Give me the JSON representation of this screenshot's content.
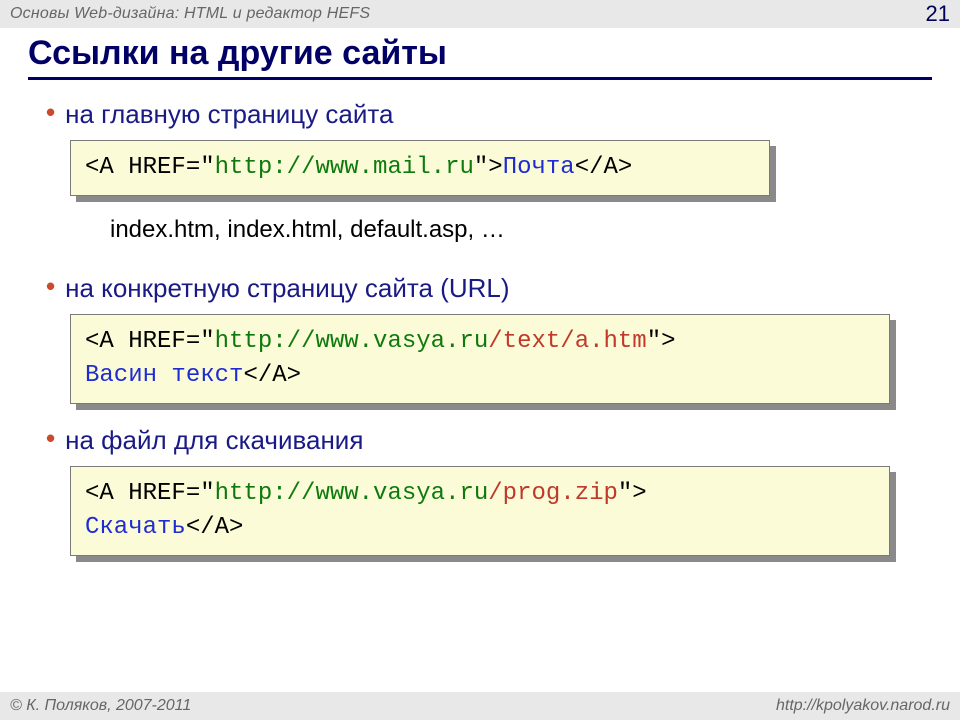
{
  "header": {
    "breadcrumb": "Основы Web-дизайна: HTML и редактор HEFS",
    "pagenum": "21"
  },
  "title": "Ссылки на другие сайты",
  "sections": [
    {
      "bullet": "на главную страницу сайта",
      "code": {
        "p1": "<A HREF=\"",
        "url": "http://www.mail.ru",
        "p2": "\">",
        "linktext": "Почта",
        "p3": "</A>"
      },
      "note": "index.htm, index.html, default.asp, …"
    },
    {
      "bullet": "на конкретную страницу сайта (URL)",
      "code": {
        "p1": "<A HREF=\"",
        "url": "http://www.vasya.ru",
        "path": "/text/a.htm",
        "p2": "\">",
        "br": true,
        "linktext": "Васин текст",
        "p3": "</A>"
      }
    },
    {
      "bullet": "на файл для скачивания",
      "code": {
        "p1": "<A HREF=\"",
        "url": "http://www.vasya.ru",
        "path": "/prog.zip",
        "p2": "\">",
        "br": true,
        "linktext": "Скачать",
        "p3": "</A>"
      }
    }
  ],
  "footer": {
    "left": "© К. Поляков, 2007-2011",
    "right": "http://kpolyakov.narod.ru"
  }
}
